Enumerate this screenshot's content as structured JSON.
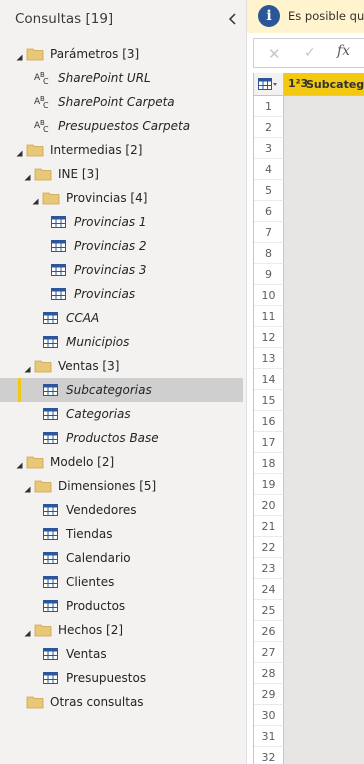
{
  "queries_pane": {
    "title": "Consultas [19]",
    "collapse_icon": "chevron-left-icon",
    "tree": [
      {
        "name": "group-parametros",
        "type": "folder",
        "label": "Parámetros [3]",
        "level": 0,
        "expanded": true
      },
      {
        "name": "query-sharepoint-url",
        "type": "param",
        "label": "SharePoint URL",
        "level": 1,
        "italic": true
      },
      {
        "name": "query-sharepoint-carpeta",
        "type": "param",
        "label": "SharePoint Carpeta",
        "level": 1,
        "italic": true
      },
      {
        "name": "query-presupuestos-carpeta",
        "type": "param",
        "label": "Presupuestos Carpeta",
        "level": 1,
        "italic": true
      },
      {
        "name": "group-intermedias",
        "type": "folder",
        "label": "Intermedias [2]",
        "level": 0,
        "expanded": true
      },
      {
        "name": "group-ine",
        "type": "folder",
        "label": "INE [3]",
        "level": 1,
        "expanded": true
      },
      {
        "name": "group-provincias",
        "type": "folder",
        "label": "Provincias [4]",
        "level": 2,
        "expanded": true
      },
      {
        "name": "query-provincias-1",
        "type": "table",
        "label": "Provincias 1",
        "level": 3,
        "italic": true
      },
      {
        "name": "query-provincias-2",
        "type": "table",
        "label": "Provincias 2",
        "level": 3,
        "italic": true
      },
      {
        "name": "query-provincias-3",
        "type": "table",
        "label": "Provincias 3",
        "level": 3,
        "italic": true
      },
      {
        "name": "query-provincias",
        "type": "table",
        "label": "Provincias",
        "level": 3,
        "italic": true
      },
      {
        "name": "query-ccaa",
        "type": "table",
        "label": "CCAA",
        "level": 2,
        "italic": true
      },
      {
        "name": "query-municipios",
        "type": "table",
        "label": "Municipios",
        "level": 2,
        "italic": true
      },
      {
        "name": "group-ventas",
        "type": "folder",
        "label": "Ventas [3]",
        "level": 1,
        "expanded": true
      },
      {
        "name": "query-subcategorias",
        "type": "table",
        "label": "Subcategorias",
        "level": 2,
        "italic": true,
        "selected": true
      },
      {
        "name": "query-categorias",
        "type": "table",
        "label": "Categorias",
        "level": 2,
        "italic": true
      },
      {
        "name": "query-productos-base",
        "type": "table",
        "label": "Productos Base",
        "level": 2,
        "italic": true
      },
      {
        "name": "group-modelo",
        "type": "folder",
        "label": "Modelo [2]",
        "level": 0,
        "expanded": true
      },
      {
        "name": "group-dimensiones",
        "type": "folder",
        "label": "Dimensiones [5]",
        "level": 1,
        "expanded": true
      },
      {
        "name": "query-vendedores",
        "type": "table",
        "label": "Vendedores",
        "level": 2
      },
      {
        "name": "query-tiendas",
        "type": "table",
        "label": "Tiendas",
        "level": 2
      },
      {
        "name": "query-calendario",
        "type": "table",
        "label": "Calendario",
        "level": 2
      },
      {
        "name": "query-clientes",
        "type": "table",
        "label": "Clientes",
        "level": 2
      },
      {
        "name": "query-productos",
        "type": "table",
        "label": "Productos",
        "level": 2
      },
      {
        "name": "group-hechos",
        "type": "folder",
        "label": "Hechos [2]",
        "level": 1,
        "expanded": true
      },
      {
        "name": "query-ventas",
        "type": "table",
        "label": "Ventas",
        "level": 2
      },
      {
        "name": "query-presupuestos",
        "type": "table",
        "label": "Presupuestos",
        "level": 2
      },
      {
        "name": "group-otras-consultas",
        "type": "folder",
        "label": "Otras consultas",
        "level": 0,
        "expanded": false
      }
    ]
  },
  "info_bar": {
    "icon": "info-icon",
    "icon_glyph": "i",
    "text": "Es posible que"
  },
  "formula_bar": {
    "cancel_glyph": "✕",
    "confirm_glyph": "✓",
    "fx_glyph": "fx"
  },
  "grid": {
    "column_type_glyph": "1²3",
    "column_name": "Subcategoria",
    "row_numbers": [
      "1",
      "2",
      "3",
      "4",
      "5",
      "6",
      "7",
      "8",
      "9",
      "10",
      "11",
      "12",
      "13",
      "14",
      "15",
      "16",
      "17",
      "18",
      "19",
      "20",
      "21",
      "22",
      "23",
      "24",
      "25",
      "26",
      "27",
      "28",
      "29",
      "30",
      "31",
      "32"
    ]
  },
  "colors": {
    "accent_yellow": "#f2c811",
    "folder": "#e8c777",
    "table_icon": "#2b579a",
    "info_bg": "#fff4ce"
  }
}
